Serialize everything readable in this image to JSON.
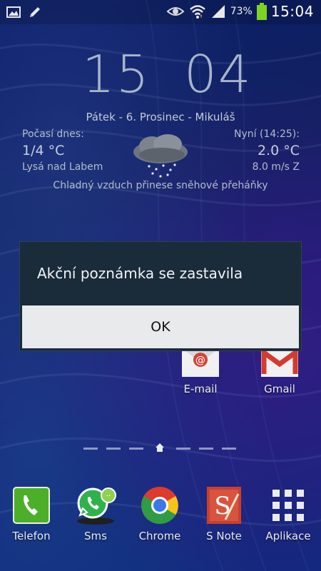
{
  "status_bar": {
    "battery_percent": "73%",
    "time": "15:04",
    "left_icons": [
      "gallery-icon",
      "pencil-icon"
    ],
    "right_icons": [
      "eye-icon",
      "wifi-icon",
      "signal-icon",
      "battery-icon"
    ]
  },
  "clock_widget": {
    "hour": "15",
    "minute": "04",
    "date": "Pátek - 6. Prosinec - Mikuláš",
    "today_label": "Počasí dnes:",
    "today_range": "1/4 °C",
    "location": "Lysá nad Labem",
    "now_label": "Nyní (14:25):",
    "now_temp": "2.0 °C",
    "wind": "8.0 m/s  Z",
    "forecast": "Chladný vzduch přinese sněhové přeháňky",
    "weather_icon": "snow-cloud-icon"
  },
  "dialog": {
    "message": "Akční poznámka se zastavila",
    "ok_label": "OK"
  },
  "home_apps": [
    {
      "label": "E-mail",
      "icon": "email-icon"
    },
    {
      "label": "Gmail",
      "icon": "gmail-icon"
    }
  ],
  "dock": [
    {
      "label": "Telefon",
      "icon": "phone-icon"
    },
    {
      "label": "Sms",
      "icon": "whatsapp-icon"
    },
    {
      "label": "Chrome",
      "icon": "chrome-icon"
    },
    {
      "label": "S Note",
      "icon": "snote-icon"
    },
    {
      "label": "Aplikace",
      "icon": "apps-grid-icon"
    }
  ],
  "page_indicator": {
    "page_count": 7,
    "current": "home"
  },
  "colors": {
    "dialog_bg": "#1a2b3a",
    "ok_button_bg": "#e8eaec",
    "battery_green": "#7ed321"
  }
}
